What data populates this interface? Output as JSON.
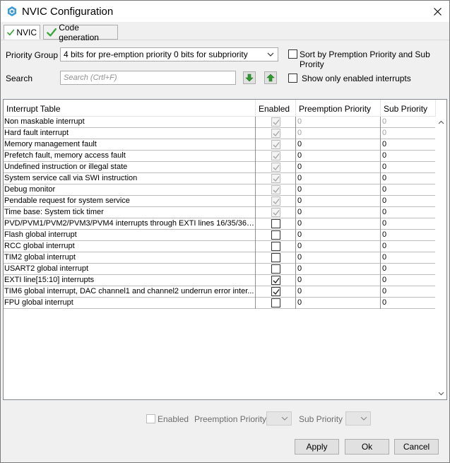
{
  "window": {
    "title": "NVIC Configuration"
  },
  "tabs": [
    {
      "label": "NVIC",
      "active": true
    },
    {
      "label": "Code generation",
      "active": false
    }
  ],
  "priority_group": {
    "label": "Priority Group",
    "value": "4 bits for pre-emption priority 0 bits for subpriority"
  },
  "sort_option": {
    "label": "Sort by Premption Priority and Sub Prority",
    "checked": false
  },
  "search": {
    "label": "Search",
    "placeholder": "Search (Crtl+F)",
    "value": ""
  },
  "show_enabled_option": {
    "label": "Show only enabled interrupts",
    "checked": false
  },
  "table": {
    "headers": {
      "name": "Interrupt Table",
      "enabled": "Enabled",
      "preemption": "Preemption Priority",
      "sub": "Sub Priority"
    },
    "rows": [
      {
        "name": "Non maskable interrupt",
        "enabled": true,
        "fixed": true,
        "preemption": "0",
        "sub": "0",
        "disabled_priority": true
      },
      {
        "name": "Hard fault interrupt",
        "enabled": true,
        "fixed": true,
        "preemption": "0",
        "sub": "0",
        "disabled_priority": true
      },
      {
        "name": "Memory management fault",
        "enabled": true,
        "fixed": true,
        "preemption": "0",
        "sub": "0",
        "disabled_priority": false
      },
      {
        "name": "Prefetch fault, memory access fault",
        "enabled": true,
        "fixed": true,
        "preemption": "0",
        "sub": "0",
        "disabled_priority": false
      },
      {
        "name": "Undefined instruction or illegal state",
        "enabled": true,
        "fixed": true,
        "preemption": "0",
        "sub": "0",
        "disabled_priority": false
      },
      {
        "name": "System service call via SWI instruction",
        "enabled": true,
        "fixed": true,
        "preemption": "0",
        "sub": "0",
        "disabled_priority": false
      },
      {
        "name": "Debug monitor",
        "enabled": true,
        "fixed": true,
        "preemption": "0",
        "sub": "0",
        "disabled_priority": false
      },
      {
        "name": "Pendable request for system service",
        "enabled": true,
        "fixed": true,
        "preemption": "0",
        "sub": "0",
        "disabled_priority": false
      },
      {
        "name": "Time base: System tick timer",
        "enabled": true,
        "fixed": true,
        "preemption": "0",
        "sub": "0",
        "disabled_priority": false
      },
      {
        "name": "PVD/PVM1/PVM2/PVM3/PVM4 interrupts through EXTI lines 16/35/36/37...",
        "enabled": false,
        "fixed": false,
        "preemption": "0",
        "sub": "0",
        "disabled_priority": false
      },
      {
        "name": "Flash global interrupt",
        "enabled": false,
        "fixed": false,
        "preemption": "0",
        "sub": "0",
        "disabled_priority": false
      },
      {
        "name": "RCC global interrupt",
        "enabled": false,
        "fixed": false,
        "preemption": "0",
        "sub": "0",
        "disabled_priority": false
      },
      {
        "name": "TIM2 global interrupt",
        "enabled": false,
        "fixed": false,
        "preemption": "0",
        "sub": "0",
        "disabled_priority": false
      },
      {
        "name": "USART2 global interrupt",
        "enabled": false,
        "fixed": false,
        "preemption": "0",
        "sub": "0",
        "disabled_priority": false
      },
      {
        "name": "EXTI line[15:10] interrupts",
        "enabled": true,
        "fixed": false,
        "preemption": "0",
        "sub": "0",
        "disabled_priority": false
      },
      {
        "name": "TIM6 global interrupt, DAC channel1 and channel2 underrun error inter...",
        "enabled": true,
        "fixed": false,
        "preemption": "0",
        "sub": "0",
        "disabled_priority": false
      },
      {
        "name": "FPU global interrupt",
        "enabled": false,
        "fixed": false,
        "preemption": "0",
        "sub": "0",
        "disabled_priority": false
      }
    ]
  },
  "editor": {
    "enabled_label": "Enabled",
    "preemption_label": "Preemption Priority",
    "sub_label": "Sub Priority"
  },
  "buttons": {
    "apply": "Apply",
    "ok": "Ok",
    "cancel": "Cancel"
  },
  "colors": {
    "check_green": "#3aa53a",
    "arrow_green": "#2e9a2e",
    "app_icon": "#3b9ad9"
  }
}
